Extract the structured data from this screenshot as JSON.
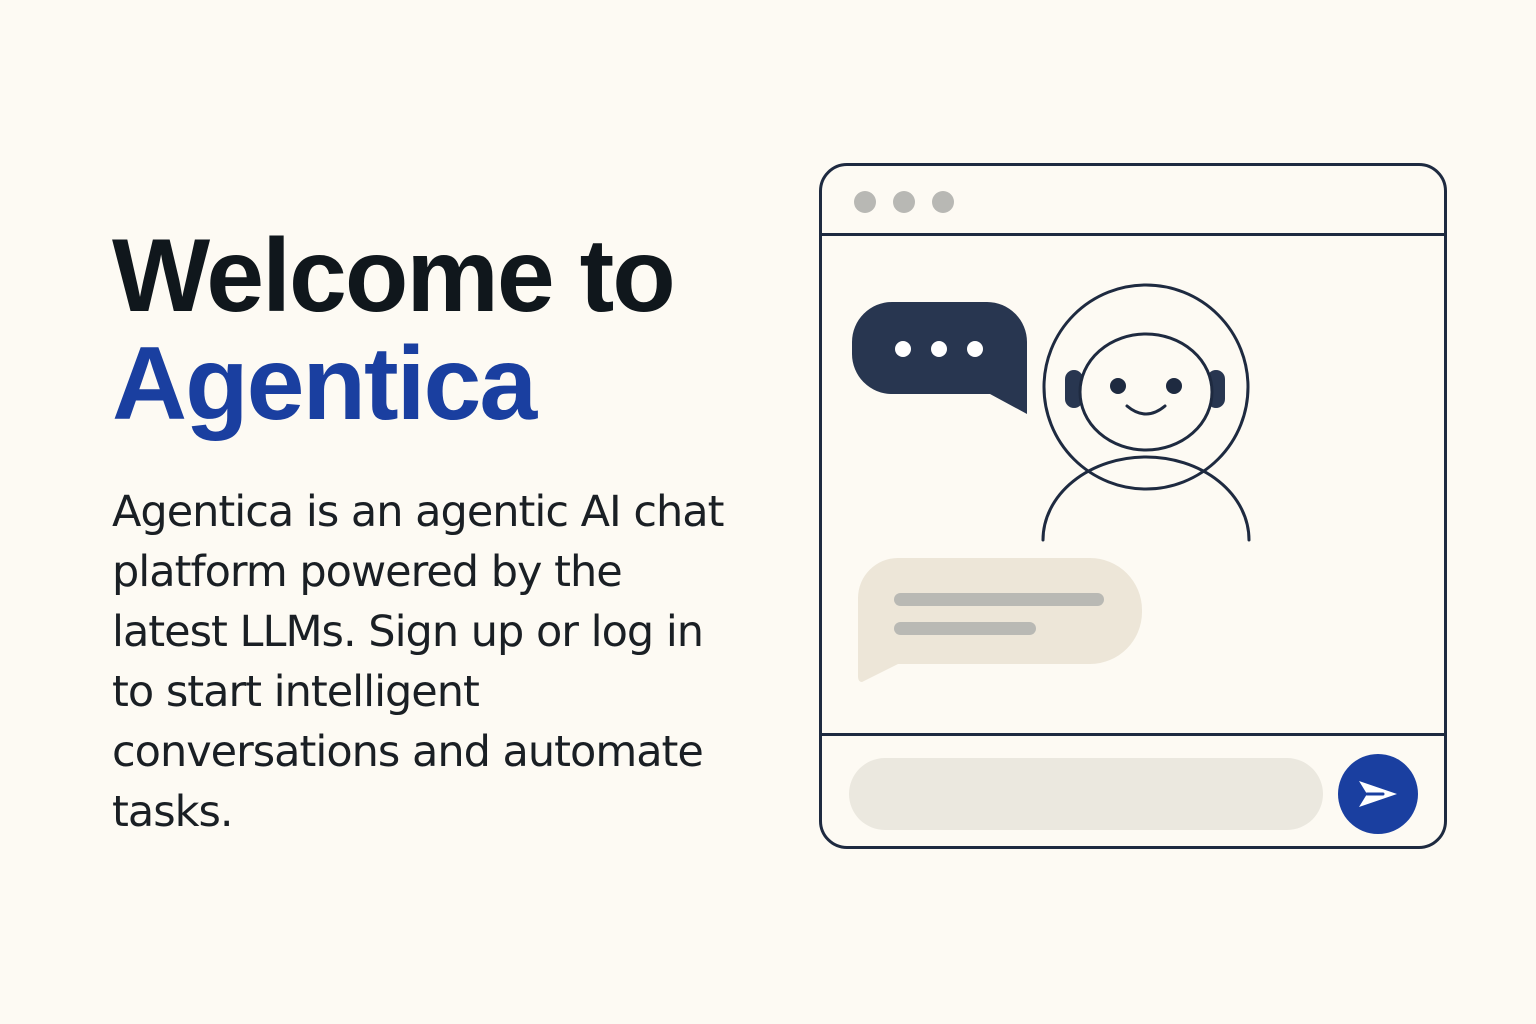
{
  "hero": {
    "title_line1": "Welcome to",
    "title_line2": "Agentica",
    "description": "Agentica is an agentic AI chat platform powered by the latest LLMs. Sign up or log in to start intelligent conversations and automate tasks."
  },
  "chat_window": {
    "window_controls": [
      "dot",
      "dot",
      "dot"
    ],
    "typing_bubble_icon": "ellipsis-icon",
    "avatar_icon": "robot-avatar-icon",
    "reply_bubble_icon": "message-placeholder-icon",
    "composer": {
      "input_value": "",
      "send_icon": "send-icon"
    }
  },
  "colors": {
    "background": "#fdfaf3",
    "heading": "#10171c",
    "brand_accent": "#1a3fa0",
    "outline": "#1e2a40",
    "typing_bubble": "#283650",
    "reply_bubble": "#ede6d8",
    "input_fill": "#ebe8df"
  }
}
